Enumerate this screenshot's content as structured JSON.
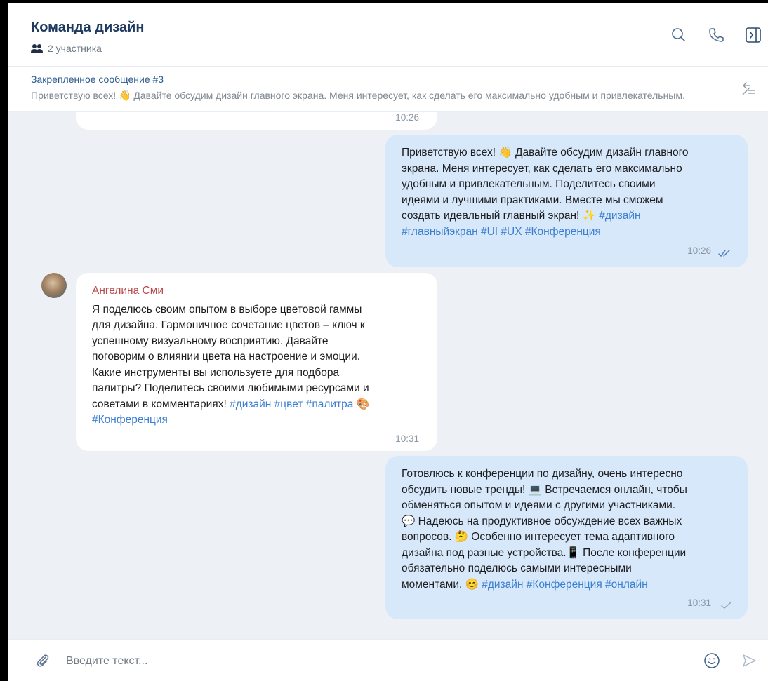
{
  "header": {
    "title": "Команда дизайн",
    "participants": "2 участника"
  },
  "pinned": {
    "title": "Закрепленное сообщение #3",
    "text": "Приветствую всех! 👋 Давайте обсудим дизайн главного экрана. Меня интересует, как сделать его максимально удобным и привлекательным."
  },
  "messages": [
    {
      "id": "prev",
      "time": "10:26"
    },
    {
      "id": "m1",
      "direction": "outgoing",
      "lines": [
        "Приветствую всех! 👋 Давайте обсудим дизайн главного",
        "экрана.  Меня интересует, как сделать его максимально",
        "удобным и привлекательным.  Поделитесь своими",
        "идеями и лучшими практиками.  Вместе мы сможем",
        "создать идеальный главный экран! ✨ ",
        ""
      ],
      "hashtags_line5": "#дизайн",
      "hashtags_line6": "#главныйэкран #UI #UX #Конференция",
      "time": "10:26",
      "status": "read"
    },
    {
      "id": "m2",
      "direction": "incoming",
      "author": "Ангелина Сми",
      "lines": [
        "Я поделюсь своим опытом в выборе цветовой гаммы",
        "для дизайна.  Гармоничное сочетание цветов – ключ к",
        "успешному визуальному восприятию.  Давайте",
        "поговорим о влиянии цвета на настроение и эмоции.",
        "Какие инструменты вы используете для подбора",
        "палитры?  Поделитесь своими любимыми ресурсами и",
        "советами в комментариях! "
      ],
      "hashtags_line7": "#дизайн #цвет #палитра",
      "hashtags_line8": "#Конференция",
      "time": "10:31"
    },
    {
      "id": "m3",
      "direction": "outgoing",
      "lines": [
        "Готовлюсь к конференции по дизайну, очень интересно",
        "обсудить новые тренды! 💻  Встречаемся онлайн, чтобы",
        "обменяться опытом и идеями с другими участниками.",
        "💬  Надеюсь на продуктивное обсуждение всех важных",
        "вопросов. 🤔  Особенно интересует тема адаптивного",
        "дизайна под разные устройства.📱 После конференции",
        "обязательно поделюсь самыми интересными",
        "моментами. 😊 "
      ],
      "hashtags_line8": "#дизайн #Конференция #онлайн",
      "time": "10:31",
      "status": "sent"
    }
  ],
  "composer": {
    "placeholder": "Введите текст..."
  },
  "colors": {
    "outgoing_bubble": "#d7e8fa",
    "incoming_bubble": "#ffffff",
    "hashtag": "#3b7fd0",
    "author": "#b94a4a",
    "title": "#1f3a60"
  }
}
